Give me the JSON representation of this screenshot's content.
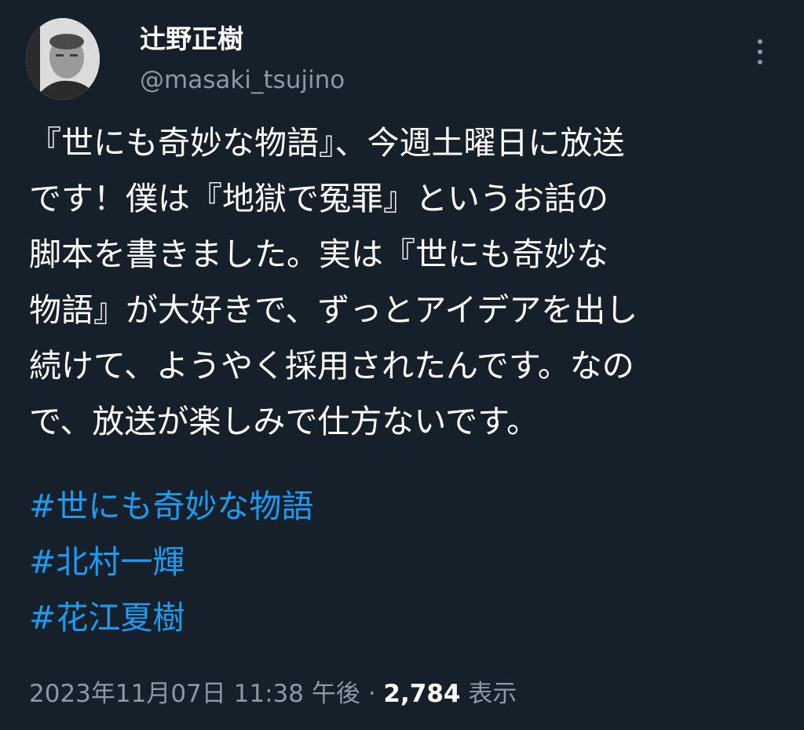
{
  "author": {
    "display_name": "辻野正樹",
    "handle": "@masaki_tsujino"
  },
  "more_icon": "more-vertical-icon",
  "tweet": {
    "lines": [
      "『世にも奇妙な物語』、今週土曜日に放送",
      "です！僕は『地獄で冤罪』というお話の",
      "脚本を書きました。実は『世にも奇妙な",
      "物語』が大好きで、ずっとアイデアを出し",
      "続けて、ようやく採用されたんです。なの",
      "で、放送が楽しみで仕方ないです。"
    ],
    "hashtags": [
      "#世にも奇妙な物語",
      "#北村一輝",
      "#花江夏樹"
    ]
  },
  "meta": {
    "timestamp": "2023年11月07日 11:38 午後",
    "separator": "·",
    "views_count": "2,784",
    "views_label": "表示"
  },
  "colors": {
    "background": "#15202b",
    "text": "#ffffff",
    "secondary": "#8b98a5",
    "link": "#1d9bf0"
  }
}
